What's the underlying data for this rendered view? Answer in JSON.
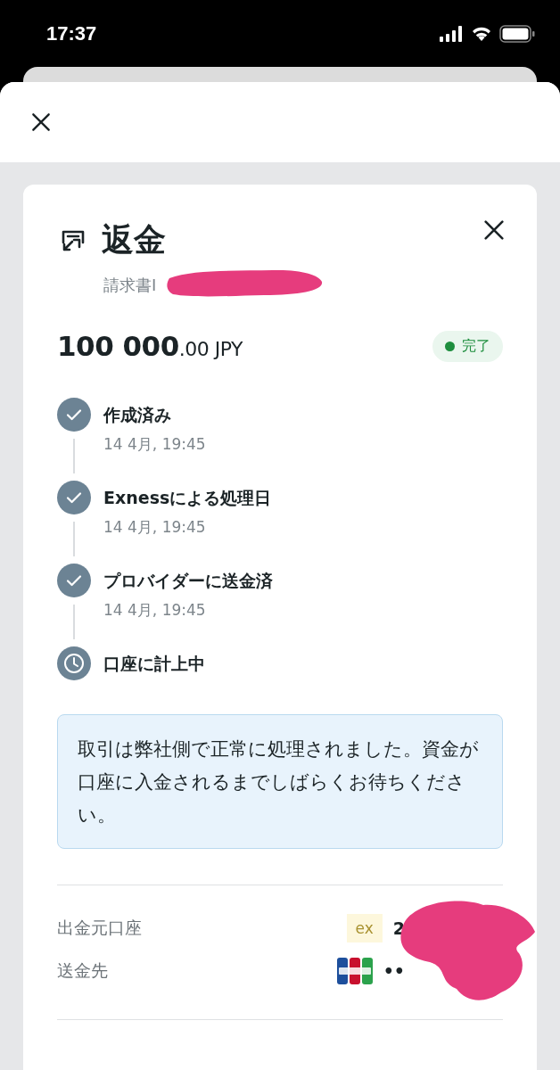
{
  "status_bar": {
    "time": "17:37"
  },
  "refund": {
    "title": "返金",
    "invoice_label": "請求書I",
    "amount": {
      "integer": "100 000",
      "decimals": ".00",
      "currency": "JPY"
    },
    "status": {
      "label": "完了",
      "color": "#1e8e3e"
    },
    "steps": [
      {
        "kind": "done",
        "title": "作成済み",
        "time": "14 4月, 19:45"
      },
      {
        "kind": "done",
        "title": "Exnessによる処理日",
        "time": "14 4月, 19:45"
      },
      {
        "kind": "done",
        "title": "プロバイダーに送金済",
        "time": "14 4月, 19:45"
      },
      {
        "kind": "pending",
        "title": "口座に計上中"
      }
    ],
    "notice": "取引は弊社側で正常に処理されました。資金が口座に入金されるまでしばらくお待ちください。",
    "details": [
      {
        "kind": "account",
        "label": "出金元口座",
        "badge": "ex",
        "value": "2"
      },
      {
        "kind": "card",
        "label": "送金先",
        "value": "••"
      }
    ]
  }
}
